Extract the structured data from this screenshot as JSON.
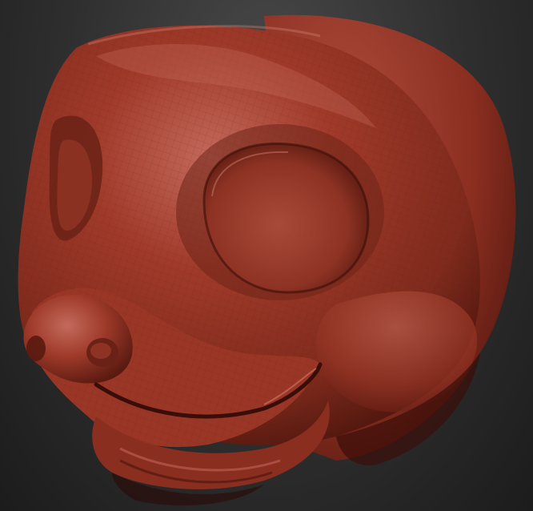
{
  "scene": {
    "background_colors": [
      "#4a4a4a",
      "#2e2e2e",
      "#1c1c1c"
    ],
    "material_colors": {
      "highlight": "#c46a5c",
      "base": "#a03a2a",
      "mid": "#7e2a1c",
      "shadow": "#4a140c",
      "deep_shadow": "#2a0a06",
      "mesh_line": "#5a1a10"
    },
    "subject": "sculpted-creature-head"
  }
}
